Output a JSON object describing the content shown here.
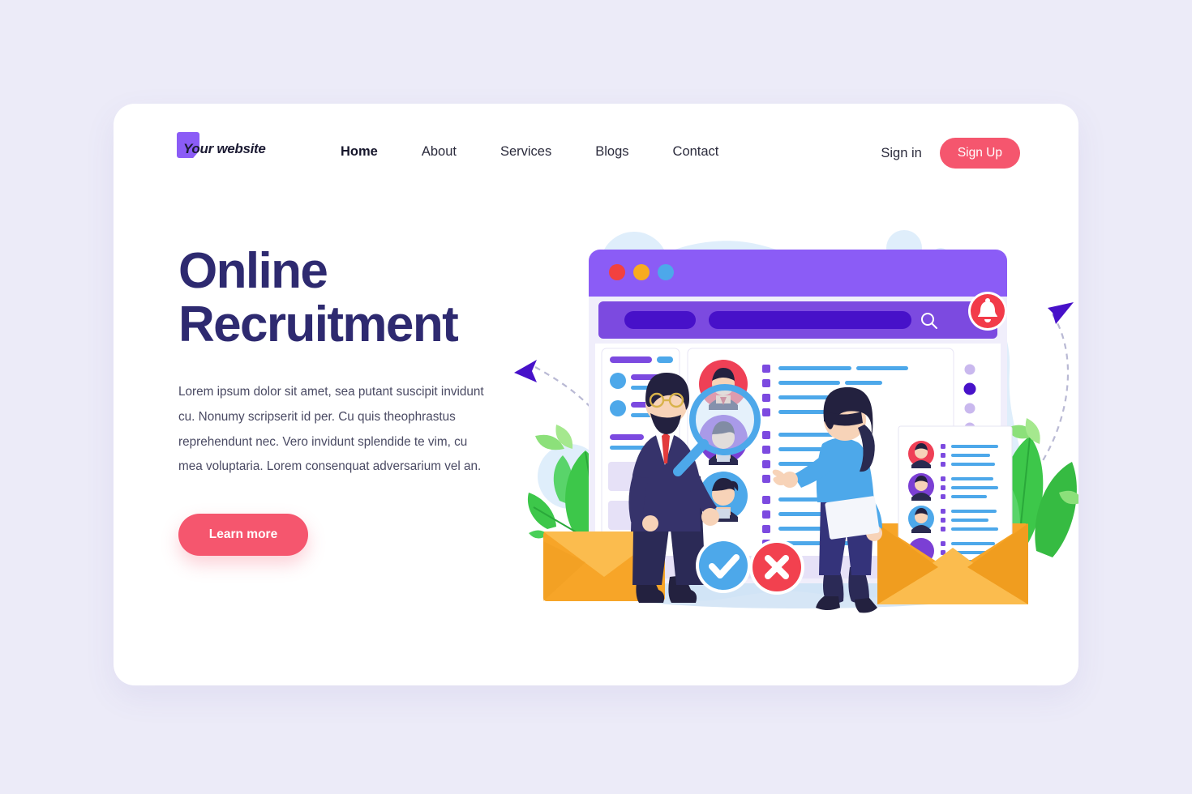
{
  "brand": {
    "logo_text": "Your website",
    "logo_color": "#8b5cf6"
  },
  "nav": {
    "items": [
      {
        "label": "Home",
        "active": true
      },
      {
        "label": "About",
        "active": false
      },
      {
        "label": "Services",
        "active": false
      },
      {
        "label": "Blogs",
        "active": false
      },
      {
        "label": "Contact",
        "active": false
      }
    ],
    "signin_label": "Sign in",
    "signup_label": "Sign Up",
    "signup_color": "#f5566e"
  },
  "hero": {
    "title": "Online\nRecruitment",
    "title_color": "#2e2a70",
    "paragraph": "Lorem ipsum dolor sit amet, sea putant suscipit invidunt cu. Nonumy scripserit id per. Cu quis theophrastus reprehendunt nec. Vero invidunt splendide te vim, cu mea voluptaria. Lorem consenquat adversarium vel an.",
    "cta_label": "Learn more",
    "cta_color": "#f5566e"
  },
  "illustration": {
    "name": "online-recruitment-illustration",
    "browser_window": {
      "titlebar_color": "#8b5cf6",
      "traffic_lights": [
        "#f2413f",
        "#f8ab20",
        "#4da8ea"
      ],
      "search_icon": "search-icon",
      "notification_icon": "bell-icon",
      "notification_color": "#f23b49"
    },
    "decision_buttons": [
      {
        "name": "approve-check-button",
        "icon": "check-icon",
        "color": "#4da8ea"
      },
      {
        "name": "reject-close-button",
        "icon": "close-icon",
        "color": "#f2414f"
      }
    ],
    "candidate_avatars": [
      "#ef4056",
      "#7b3fd4",
      "#4da8ea"
    ],
    "resume_avatars": [
      "#ef4056",
      "#7b3fd4",
      "#4da8ea",
      "#7b3fd4"
    ],
    "envelope_color": "#f7a528",
    "plant_color": "#3dc74a",
    "pagination_active_index": 1,
    "pagination_dots": 5,
    "arrow_color": "#4711c9",
    "blob_color": "#dfeefb"
  }
}
